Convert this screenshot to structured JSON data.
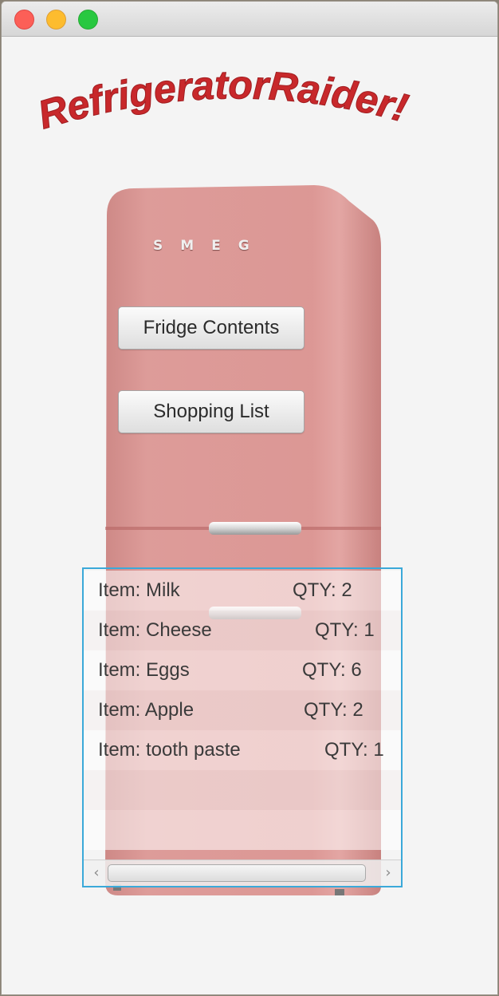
{
  "window": {
    "title_lights": [
      "close",
      "minimize",
      "zoom"
    ]
  },
  "header": {
    "logo_text": "RefrigeratorRaider!",
    "logo_color": "#c8282b"
  },
  "fridge": {
    "brand": "SMEG",
    "body_color": "#d98a87"
  },
  "buttons": {
    "fridge_contents": "Fridge Contents",
    "shopping_list": "Shopping List"
  },
  "contents": {
    "items": [
      {
        "item": "Item: Milk",
        "qty": "QTY: 2"
      },
      {
        "item": "Item: Cheese",
        "qty": "QTY: 1"
      },
      {
        "item": "Item: Eggs",
        "qty": "QTY: 6"
      },
      {
        "item": "Item: Apple",
        "qty": "QTY: 2"
      },
      {
        "item": "Item: tooth paste",
        "qty": "QTY: 1"
      }
    ],
    "selection_color": "#3ba9d9"
  },
  "scrollbar": {
    "left_arrow": "‹",
    "right_arrow": "›"
  }
}
